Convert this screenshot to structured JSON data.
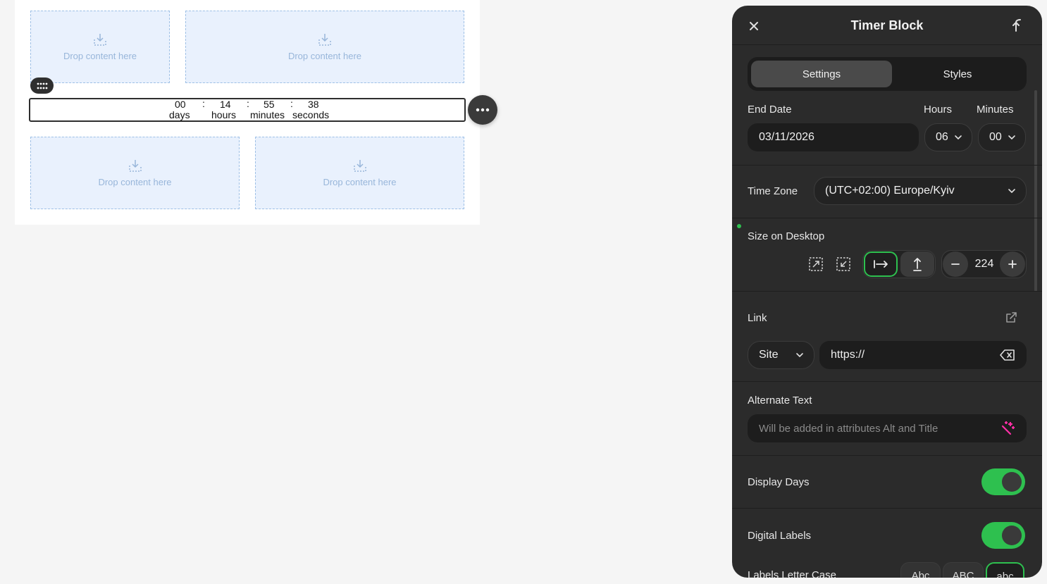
{
  "canvas": {
    "drop_zones": [
      {
        "label": "Drop content here"
      },
      {
        "label": "Drop content here"
      },
      {
        "label": "Drop content here"
      },
      {
        "label": "Drop content here"
      }
    ],
    "timer": {
      "days": "00",
      "hours": "14",
      "minutes": "55",
      "seconds": "38",
      "separator": ":",
      "days_label": "days",
      "hours_label": "hours",
      "minutes_label": "minutes",
      "seconds_label": "seconds"
    }
  },
  "panel": {
    "title": "Timer Block",
    "tabs": [
      {
        "label": "Settings",
        "active": true
      },
      {
        "label": "Styles",
        "active": false
      }
    ],
    "end_date": {
      "label": "End Date",
      "value": "03/11/2026"
    },
    "hours": {
      "label": "Hours",
      "value": "06"
    },
    "minutes": {
      "label": "Minutes",
      "value": "00"
    },
    "time_zone": {
      "label": "Time Zone",
      "value": "(UTC+02:00) Europe/Kyiv"
    },
    "size": {
      "label": "Size on Desktop",
      "value": "224"
    },
    "link": {
      "label": "Link",
      "type": "Site",
      "placeholder": "https://"
    },
    "alt_text": {
      "label": "Alternate Text",
      "placeholder": "Will be added in attributes Alt and Title"
    },
    "display_days": {
      "label": "Display Days",
      "enabled": true
    },
    "digital_labels": {
      "label": "Digital Labels",
      "enabled": true
    },
    "letter_case": {
      "label": "Labels Letter Case",
      "options": [
        "Abc",
        "ABC",
        "abc"
      ],
      "selected": "abc"
    }
  },
  "colors": {
    "accent": "#2ec04f",
    "panel_bg": "#2b2b2b",
    "drop_bg": "#e9f1fd",
    "magic_icon": "#ff2fa7"
  },
  "icons": [
    "drop-download-icon",
    "drag-grid-icon",
    "more-dots-icon",
    "close-icon",
    "pin-icon",
    "chevron-down-icon",
    "fit-size-icon",
    "shrink-size-icon",
    "width-arrow-icon",
    "height-arrow-icon",
    "minus-icon",
    "plus-icon",
    "external-link-icon",
    "clear-input-icon",
    "magic-wand-icon"
  ]
}
